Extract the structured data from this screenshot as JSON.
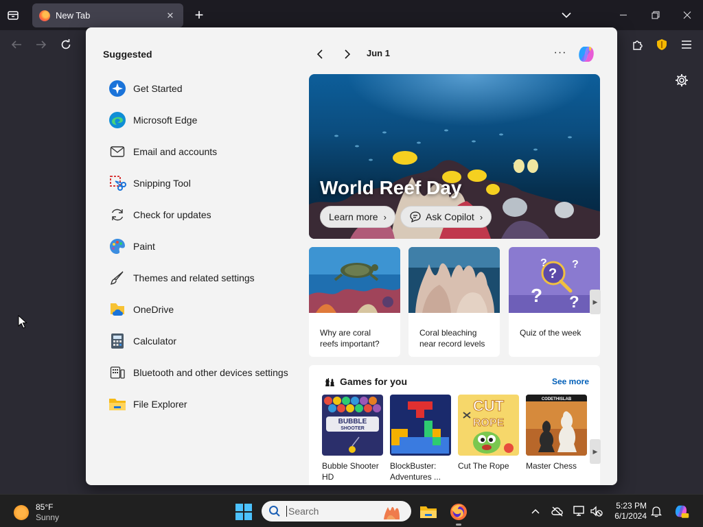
{
  "browser": {
    "tab_title": "New Tab",
    "tab_close_glyph": "✕",
    "new_tab_glyph": "+"
  },
  "widgets": {
    "suggested_title": "Suggested",
    "suggested_apps": [
      {
        "label": "Get Started",
        "icon": "get-started-icon"
      },
      {
        "label": "Microsoft Edge",
        "icon": "edge-icon"
      },
      {
        "label": "Email and accounts",
        "icon": "mail-icon"
      },
      {
        "label": "Snipping Tool",
        "icon": "snipping-tool-icon"
      },
      {
        "label": "Check for updates",
        "icon": "refresh-icon"
      },
      {
        "label": "Paint",
        "icon": "paint-icon"
      },
      {
        "label": "Themes and related settings",
        "icon": "brush-icon"
      },
      {
        "label": "OneDrive",
        "icon": "onedrive-icon"
      },
      {
        "label": "Calculator",
        "icon": "calculator-icon"
      },
      {
        "label": "Bluetooth and other devices settings",
        "icon": "devices-icon"
      },
      {
        "label": "File Explorer",
        "icon": "folder-icon"
      }
    ],
    "feed_date": "Jun 1",
    "more_glyph": "···",
    "hero": {
      "title": "World Reef Day",
      "learn_more": "Learn more",
      "ask_copilot": "Ask Copilot"
    },
    "stories": [
      {
        "text": "Why are coral reefs important?"
      },
      {
        "text": "Coral bleaching near record levels"
      },
      {
        "text": "Quiz of the week"
      }
    ],
    "games": {
      "title": "Games for you",
      "see_more": "See more",
      "items": [
        {
          "label": "Bubble Shooter HD",
          "art": "BUBBLE SHOOTER"
        },
        {
          "label": "BlockBuster: Adventures ...",
          "art": ""
        },
        {
          "label": "Cut The Rope",
          "art": "CUT the ROPE"
        },
        {
          "label": "Master Chess",
          "art": "CODETHISLAB"
        }
      ]
    }
  },
  "taskbar": {
    "weather_temp": "85°F",
    "weather_cond": "Sunny",
    "search_placeholder": "Search",
    "time": "5:23 PM",
    "date": "6/1/2024"
  },
  "colors": {
    "link": "#005fb8",
    "panel_bg": "#f3f3f3",
    "browser_bg": "#2b2a33",
    "taskbar_bg": "#202020"
  }
}
